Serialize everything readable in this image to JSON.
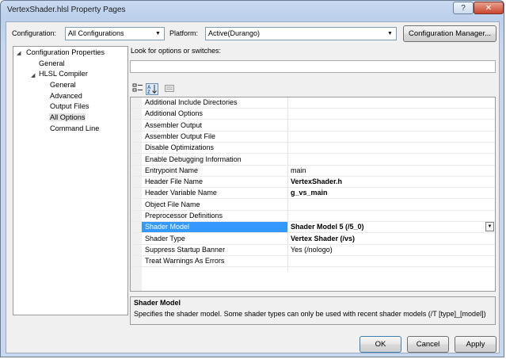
{
  "window": {
    "title": "VertexShader.hlsl Property Pages",
    "help_glyph": "?",
    "close_glyph": "✕"
  },
  "config": {
    "configuration_label": "Configuration:",
    "configuration_value": "All Configurations",
    "platform_label": "Platform:",
    "platform_value": "Active(Durango)",
    "manager_button": "Configuration Manager..."
  },
  "tree": {
    "expander_expanded": "◢",
    "root": "Configuration Properties",
    "items": [
      {
        "label": "General"
      },
      {
        "label": "HLSL Compiler"
      },
      {
        "label": "General"
      },
      {
        "label": "Advanced"
      },
      {
        "label": "Output Files"
      },
      {
        "label": "All Options"
      },
      {
        "label": "Command Line"
      }
    ]
  },
  "search": {
    "label": "Look for options or switches:",
    "value": ""
  },
  "properties": [
    {
      "name": "Additional Include Directories",
      "value": "",
      "bold": false
    },
    {
      "name": "Additional Options",
      "value": "",
      "bold": false
    },
    {
      "name": "Assembler Output",
      "value": "",
      "bold": false
    },
    {
      "name": "Assembler Output File",
      "value": "",
      "bold": false
    },
    {
      "name": "Disable Optimizations",
      "value": "",
      "bold": false
    },
    {
      "name": "Enable Debugging Information",
      "value": "",
      "bold": false
    },
    {
      "name": "Entrypoint Name",
      "value": "main",
      "bold": false
    },
    {
      "name": "Header File Name",
      "value": "VertexShader.h",
      "bold": true
    },
    {
      "name": "Header Variable Name",
      "value": "g_vs_main",
      "bold": true
    },
    {
      "name": "Object File Name",
      "value": "",
      "bold": false
    },
    {
      "name": "Preprocessor Definitions",
      "value": "",
      "bold": false
    },
    {
      "name": "Shader Model",
      "value": "Shader Model 5 (/5_0)",
      "bold": true,
      "selected": true
    },
    {
      "name": "Shader Type",
      "value": "Vertex Shader (/vs)",
      "bold": true
    },
    {
      "name": "Suppress Startup Banner",
      "value": "Yes (/nologo)",
      "bold": false
    },
    {
      "name": "Treat Warnings As Errors",
      "value": "",
      "bold": false
    }
  ],
  "description": {
    "title": "Shader Model",
    "text": "Specifies the shader model. Some shader types can only be used with recent shader models (/T [type]_[model])"
  },
  "buttons": {
    "ok": "OK",
    "cancel": "Cancel",
    "apply": "Apply"
  },
  "colors": {
    "selection": "#3399ff",
    "title_bar": "#c9daf0",
    "close": "#c8462f"
  }
}
